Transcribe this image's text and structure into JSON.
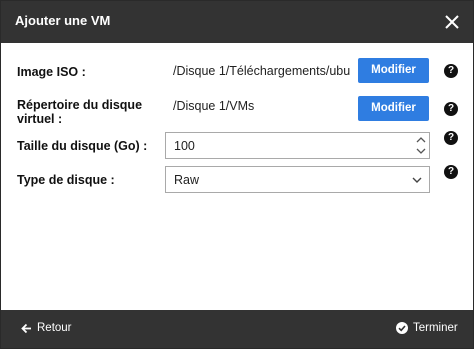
{
  "dialog": {
    "title": "Ajouter une VM"
  },
  "fields": {
    "iso": {
      "label": "Image ISO :",
      "value": "/Disque 1/Téléchargements/ubu",
      "button": "Modifier",
      "help": "?"
    },
    "vdisk_dir": {
      "label_line1": "Répertoire du disque",
      "label_line2": "virtuel :",
      "value": "/Disque 1/VMs",
      "button": "Modifier",
      "help": "?"
    },
    "disk_size": {
      "label": "Taille du disque (Go) :",
      "value": "100",
      "help": "?"
    },
    "disk_type": {
      "label": "Type de disque :",
      "value": "Raw",
      "help": "?"
    }
  },
  "footer": {
    "back_label": "Retour",
    "finish_label": "Terminer"
  },
  "icons": {
    "close": "close-icon",
    "back": "arrow-left-icon",
    "finish": "check-circle-icon"
  },
  "colors": {
    "titlebar": "#333333",
    "button": "#2f7de1",
    "footer": "#333333"
  }
}
